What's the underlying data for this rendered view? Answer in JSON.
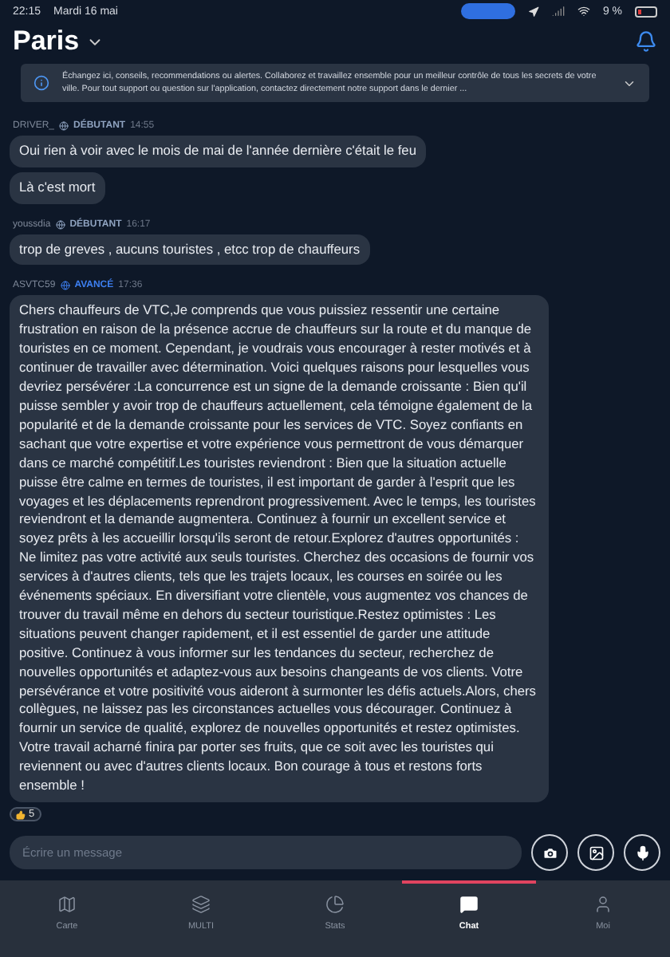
{
  "status_bar": {
    "time": "22:15",
    "date": "Mardi 16 mai",
    "battery": "9 %"
  },
  "header": {
    "title": "Paris"
  },
  "banner": {
    "text": "Échangez ici, conseils, recommendations ou alertes. Collaborez et travaillez ensemble pour un meilleur contrôle de tous les secrets de votre ville. Pour tout support ou question sur l'application, contactez directement notre support dans le dernier ..."
  },
  "messages": [
    {
      "author": "DRIVER_",
      "level": "DÉBUTANT",
      "color": "#8fa3c0",
      "time": "14:55",
      "text": "Oui rien à voir avec le mois de mai de l'année dernière c'était le feu"
    },
    {
      "text": "Là c'est mort"
    },
    {
      "author": "youssdia",
      "level": "DÉBUTANT",
      "color": "#8fa3c0",
      "time": "16:17",
      "text": "trop de greves , aucuns touristes , etcc trop de chauffeurs"
    },
    {
      "author": "ASVTC59",
      "level": "AVANCÉ",
      "color": "#3d7ff0",
      "time": "17:36",
      "text": "Chers chauffeurs de VTC,Je comprends que vous puissiez ressentir une certaine frustration en raison de la présence accrue de chauffeurs sur la route et du manque de touristes en ce moment. Cependant, je voudrais vous encourager à rester motivés et à continuer de travailler avec détermination. Voici quelques raisons pour lesquelles vous devriez persévérer :La concurrence est un signe de la demande croissante : Bien qu'il puisse sembler y avoir trop de chauffeurs actuellement, cela témoigne également de la popularité et de la demande croissante pour les services de VTC. Soyez confiants en sachant que votre expertise et votre expérience vous permettront de vous démarquer dans ce marché compétitif.Les touristes reviendront : Bien que la situation actuelle puisse être calme en termes de touristes, il est important de garder à l'esprit que les voyages et les déplacements reprendront progressivement. Avec le temps, les touristes reviendront et la demande augmentera. Continuez à fournir un excellent service et soyez prêts à les accueillir lorsqu'ils seront de retour.Explorez d'autres opportunités : Ne limitez pas votre activité aux seuls touristes. Cherchez des occasions de fournir vos services à d'autres clients, tels que les trajets locaux, les courses en soirée ou les événements spéciaux. En diversifiant votre clientèle, vous augmentez vos chances de trouver du travail même en dehors du secteur touristique.Restez optimistes : Les situations peuvent changer rapidement, et il est essentiel de garder une attitude positive. Continuez à vous informer sur les tendances du secteur, recherchez de nouvelles opportunités et adaptez-vous aux besoins changeants de vos clients. Votre persévérance et votre positivité vous aideront à surmonter les défis actuels.Alors, chers collègues, ne laissez pas les circonstances actuelles vous décourager. Continuez à fournir un service de qualité, explorez de nouvelles opportunités et restez optimistes. Votre travail acharné finira par porter ses fruits, que ce soit avec les touristes qui reviennent ou avec d'autres clients locaux. Bon courage à tous et restons forts ensemble !",
      "likes": "5"
    }
  ],
  "composer": {
    "placeholder": "Écrire un message"
  },
  "tabs": [
    {
      "kind": "map",
      "label": "Carte",
      "selected": false
    },
    {
      "kind": "layers",
      "label": "MULTI",
      "selected": false
    },
    {
      "kind": "stats",
      "label": "Stats",
      "selected": false
    },
    {
      "kind": "chat",
      "label": "Chat",
      "selected": true
    },
    {
      "kind": "user",
      "label": "Moi",
      "selected": false
    }
  ]
}
